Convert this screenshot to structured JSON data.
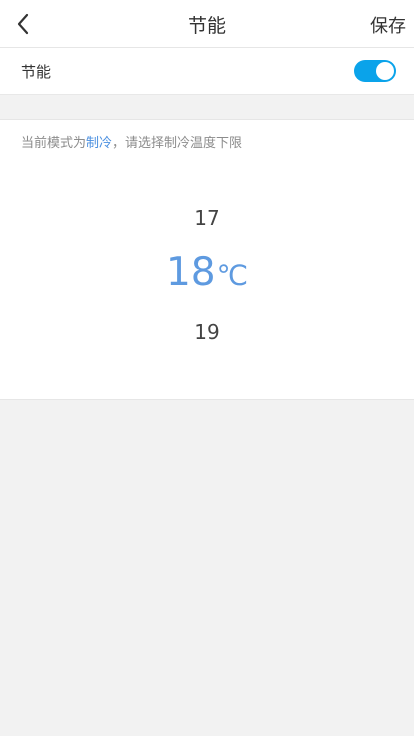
{
  "header": {
    "title": "节能",
    "save_label": "保存",
    "back_icon": "chevron-left-icon"
  },
  "energy_saving": {
    "label": "节能",
    "enabled": true,
    "toggle_color": "#0aa3ea"
  },
  "hint": {
    "prefix": "当前模式为",
    "mode": "制冷",
    "suffix": "，请选择制冷温度下限",
    "mode_color": "#4a8fe0"
  },
  "picker": {
    "prev": "17",
    "selected": "18",
    "unit": "℃",
    "next": "19",
    "selected_color": "#5e9ae0"
  }
}
